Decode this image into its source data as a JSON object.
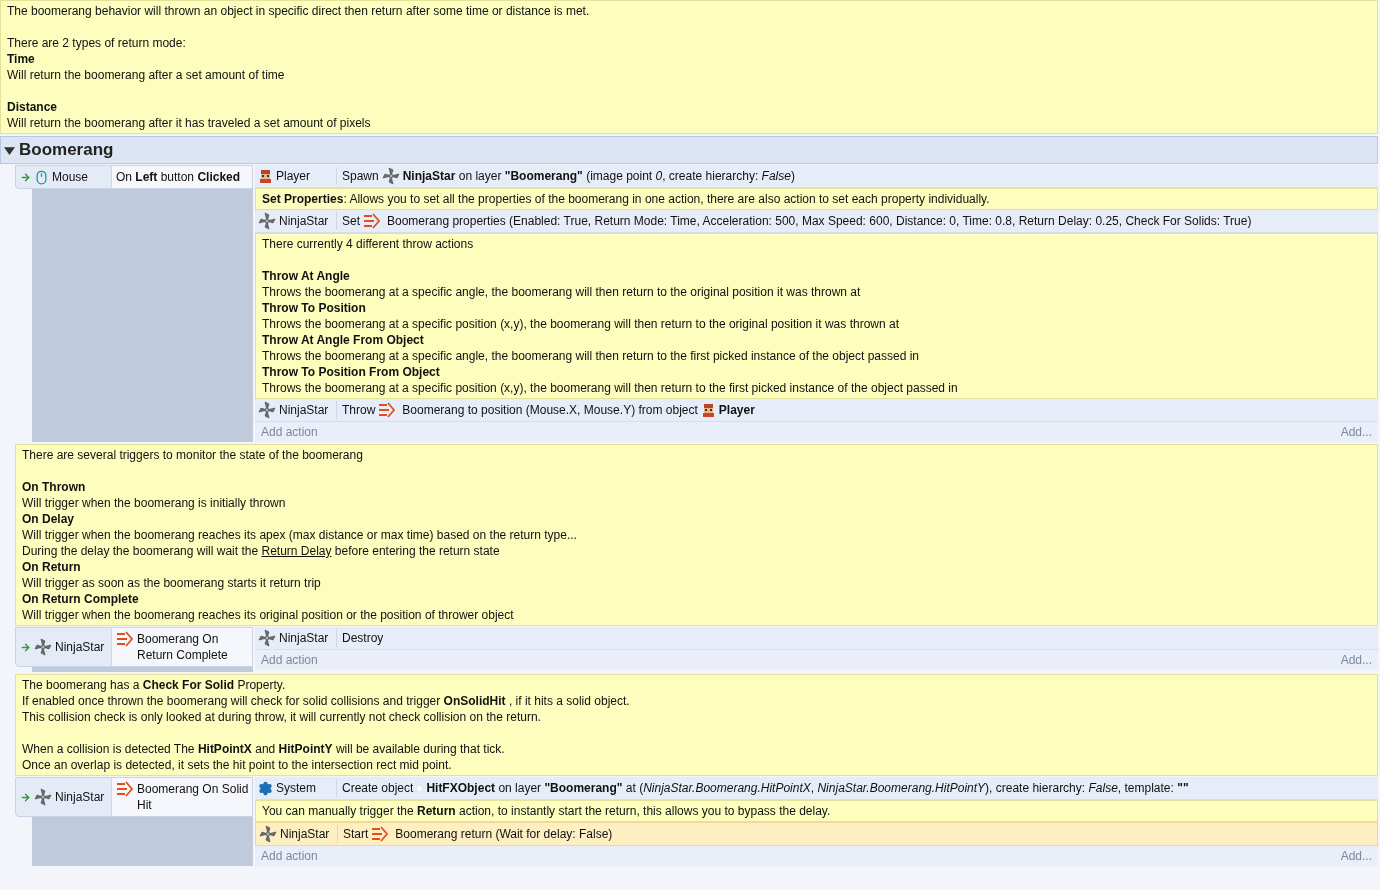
{
  "top_comment": {
    "paragraphs": [
      {
        "lines": [
          {
            "text": "The boomerang behavior will thrown an object in specific direct then return after some time or distance is met.",
            "bold": false
          }
        ]
      },
      {
        "lines": [
          {
            "text": "There are 2 types of return mode:",
            "bold": false
          },
          {
            "text": "Time",
            "bold": true
          },
          {
            "text": "Will return the boomerang after a set amount of time",
            "bold": false
          }
        ]
      },
      {
        "lines": [
          {
            "text": "Distance",
            "bold": true
          },
          {
            "text": "Will return the boomerang after it has traveled a set amount of pixels",
            "bold": false
          }
        ]
      }
    ]
  },
  "group": {
    "title": "Boomerang",
    "expanded": true,
    "items": [
      {
        "kind": "event",
        "conditions": [
          {
            "object": {
              "name": "Mouse",
              "kind": "mouse"
            },
            "segments": [
              {
                "kind": "text",
                "text": "On **Left** button **Clicked**"
              }
            ]
          }
        ],
        "actions": [
          {
            "kind": "action",
            "object": {
              "name": "Player",
              "kind": "player"
            },
            "selected": false,
            "segments": [
              {
                "kind": "text",
                "text": "Spawn"
              },
              {
                "kind": "ninja_star"
              },
              {
                "kind": "text",
                "text": "**NinjaStar** on layer **\"Boomerang\"** (image point *0*, create hierarchy: *False*)"
              }
            ]
          },
          {
            "kind": "comment",
            "paragraphs": [
              {
                "lines": [
                  {
                    "text": "**Set Properties**: Allows you to set all the properties of the boomerang in one action, there are also action to set each property individually.",
                    "bold": false
                  }
                ]
              }
            ]
          },
          {
            "kind": "action",
            "object": {
              "name": "NinjaStar",
              "kind": "ninja_star"
            },
            "selected": false,
            "segments": [
              {
                "kind": "text",
                "text": "Set"
              },
              {
                "kind": "boomerang"
              },
              {
                "kind": "text",
                "text": "Boomerang properties (Enabled: True, Return Mode: Time, Acceleration: 500, Max Speed: 600, Distance: 0, Time: 0.8, Return Delay: 0.25, Check For Solids: True)"
              }
            ]
          },
          {
            "kind": "comment",
            "paragraphs": [
              {
                "lines": [
                  {
                    "text": "There currently 4 different throw actions",
                    "bold": false
                  }
                ]
              },
              {
                "lines": [
                  {
                    "text": "Throw At Angle",
                    "bold": true
                  },
                  {
                    "text": "Throws the boomerang at a specific angle, the boomerang will then return to the original position it was thrown at",
                    "bold": false
                  },
                  {
                    "text": "Throw To Position",
                    "bold": true
                  },
                  {
                    "text": "Throws the boomerang at a specific position (x,y), the boomerang will then return to the original position it was thrown at",
                    "bold": false
                  },
                  {
                    "text": "Throw At Angle From Object",
                    "bold": true
                  },
                  {
                    "text": "Throws the boomerang at a specific angle, the boomerang will then return to the first picked instance of the object passed in",
                    "bold": false
                  },
                  {
                    "text": "Throw To Position From Object",
                    "bold": true
                  },
                  {
                    "text": "Throws the boomerang at a specific position (x,y), the boomerang will then return to the first picked instance of the object passed in",
                    "bold": false
                  }
                ]
              }
            ]
          },
          {
            "kind": "action",
            "object": {
              "name": "NinjaStar",
              "kind": "ninja_star"
            },
            "selected": false,
            "segments": [
              {
                "kind": "text",
                "text": "Throw"
              },
              {
                "kind": "boomerang"
              },
              {
                "kind": "text",
                "text": "Boomerang to position (Mouse.X, Mouse.Y) from object"
              },
              {
                "kind": "player"
              },
              {
                "kind": "text",
                "text": "**Player**"
              }
            ]
          }
        ],
        "add_action": "Add action",
        "add_more": "Add..."
      },
      {
        "kind": "comment",
        "paragraphs": [
          {
            "lines": [
              {
                "text": "There are several triggers to monitor the state of the boomerang",
                "bold": false
              }
            ]
          },
          {
            "lines": [
              {
                "text": "On Thrown",
                "bold": true
              },
              {
                "text": "Will trigger when the boomerang is initially thrown",
                "bold": false
              },
              {
                "text": "On Delay",
                "bold": true
              },
              {
                "text": "Will trigger when the boomerang reaches its apex (max distance or max time) based on the return type...",
                "bold": false
              },
              {
                "text": "During the delay the boomerang will wait the",
                "link": "Return Delay",
                "after": "before entering the return state",
                "bold": false
              },
              {
                "text": "On Return",
                "bold": true
              },
              {
                "text": "Will trigger as soon as the boomerang starts it return trip",
                "bold": false
              },
              {
                "text": "On Return Complete",
                "bold": true
              },
              {
                "text": "Will trigger when the boomerang reaches its original position or the position of thrower object",
                "bold": false
              }
            ]
          }
        ]
      },
      {
        "kind": "event",
        "conditions": [
          {
            "object": {
              "name": "NinjaStar",
              "kind": "ninja_star"
            },
            "segments": [
              {
                "kind": "boomerang"
              },
              {
                "kind": "text",
                "text": "Boomerang On Return Complete"
              }
            ]
          }
        ],
        "actions": [
          {
            "kind": "action",
            "object": {
              "name": "NinjaStar",
              "kind": "ninja_star"
            },
            "selected": false,
            "segments": [
              {
                "kind": "text",
                "text": "Destroy"
              }
            ]
          }
        ],
        "add_action": "Add action",
        "add_more": "Add..."
      },
      {
        "kind": "comment",
        "paragraphs": [
          {
            "lines": [
              {
                "text": "The boomerang has a **Check For Solid**  Property.",
                "bold": false
              },
              {
                "text": "If enabled once thrown the boomerang will check for solid collisions and trigger **OnSolidHit** , if it hits a solid object.",
                "bold": false
              },
              {
                "text": "This collision check is only looked at during throw, it will currently not check collision on the return.",
                "bold": false
              }
            ]
          },
          {
            "lines": [
              {
                "text": "When a collision is detected The **HitPointX** and **HitPointY** will be available during that tick.",
                "bold": false
              },
              {
                "text": "Once an overlap is detected, it sets the hit point to the intersection rect mid point.",
                "bold": false
              }
            ]
          }
        ]
      },
      {
        "kind": "event",
        "conditions": [
          {
            "object": {
              "name": "NinjaStar",
              "kind": "ninja_star"
            },
            "segments": [
              {
                "kind": "boomerang"
              },
              {
                "kind": "text",
                "text": "Boomerang On Solid Hit"
              }
            ]
          }
        ],
        "actions": [
          {
            "kind": "action",
            "object": {
              "name": "System",
              "kind": "system"
            },
            "selected": false,
            "segments": [
              {
                "kind": "text",
                "text": "Create object"
              },
              {
                "kind": "dot"
              },
              {
                "kind": "text",
                "text": "**HitFXObject** on layer **\"Boomerang\"** at (*NinjaStar.Boomerang.HitPointX*, *NinjaStar.Boomerang.HitPointY*), create hierarchy: *False*, template: **\"\"**"
              }
            ]
          },
          {
            "kind": "comment",
            "paragraphs": [
              {
                "lines": [
                  {
                    "text": "You can manually trigger the **Return** action, to instantly start the return, this allows you to bypass the delay.",
                    "bold": false
                  }
                ]
              }
            ]
          },
          {
            "kind": "action",
            "object": {
              "name": "NinjaStar",
              "kind": "ninja_star"
            },
            "selected": true,
            "segments": [
              {
                "kind": "text",
                "text": "Start"
              },
              {
                "kind": "boomerang"
              },
              {
                "kind": "text",
                "text": "Boomerang return (Wait for delay: False)"
              }
            ]
          }
        ],
        "add_action": "Add action",
        "add_more": "Add..."
      }
    ]
  }
}
